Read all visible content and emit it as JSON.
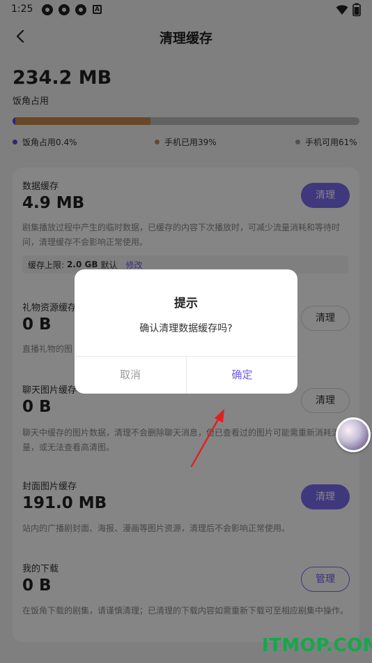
{
  "status_bar": {
    "time": "1:25",
    "icons": [
      "app-icon",
      "app-icon",
      "app-icon",
      "a-icon",
      "wifi-icon",
      "battery-icon"
    ]
  },
  "header": {
    "title": "清理缓存"
  },
  "summary": {
    "total": "234.2 MB",
    "label": "饭角占用",
    "bar": {
      "app_fraction": 0.004,
      "used_fraction": 0.39,
      "free_fraction": 0.61
    },
    "colors": {
      "app": "#5b4bd6",
      "used": "#c78a4b",
      "free": "#bdbdbd"
    },
    "legend": [
      {
        "label": "饭角占用0.4%"
      },
      {
        "label": "手机已用39%"
      },
      {
        "label": "手机可用61%"
      }
    ]
  },
  "sections": [
    {
      "title": "数据缓存",
      "size": "4.9 MB",
      "button": "清理",
      "desc": "剧集播放过程中产生的临时数据，已缓存的内容下次播放时，可减少流量消耗和等待时间，清理缓存不会影响正常使用。",
      "limit": {
        "prefix": "缓存上限:",
        "value": "2.0 GB",
        "suffix": "默认",
        "edit": "修改"
      }
    },
    {
      "title": "礼物资源缓存",
      "size": "0 B",
      "button": "清理",
      "desc": "直播礼物的图"
    },
    {
      "title": "聊天图片缓存",
      "size": "0 B",
      "button": "清理",
      "desc": "聊天中缓存的图片数据，清理不会删除聊天消息，但已查看过的图片可能需重新消耗流量，或无法查看高清图。"
    },
    {
      "title": "封面图片缓存",
      "size": "191.0 MB",
      "button": "清理",
      "desc": "站内的广播剧封面、海报、漫画等图片资源，清理后不会影响正常使用。"
    },
    {
      "title": "我的下载",
      "size": "0 B",
      "button": "管理",
      "desc": "在饭角下载的剧集，请谨慎清理；已清理的下载内容如需重新下载可至相应剧集中操作。"
    }
  ],
  "dialog": {
    "title": "提示",
    "message": "确认清理数据缓存吗?",
    "cancel": "取消",
    "confirm": "确定"
  },
  "watermark": "ITMOP.COM",
  "accent": "#7b6cf0"
}
